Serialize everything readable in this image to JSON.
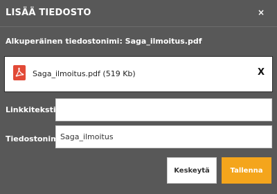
{
  "dialog": {
    "title": "LISÄÄ TIEDOSTO",
    "close_label": "×",
    "original_filename_text": "Alkuperäinen tiedostonimi: Saga_ilmoitus.pdf"
  },
  "file": {
    "icon": "pdf-icon",
    "label": "Saga_ilmoitus.pdf (519 Kb)",
    "remove_label": "X"
  },
  "form": {
    "link_text": {
      "label": "Linkkiteksti",
      "value": ""
    },
    "file_name": {
      "label": "Tiedostonimi",
      "value": "Saga_ilmoitus"
    }
  },
  "buttons": {
    "cancel": "Keskeytä",
    "save": "Tallenna"
  },
  "colors": {
    "background": "#585858",
    "accent": "#f4a51c",
    "pdf_red": "#e24a37"
  }
}
